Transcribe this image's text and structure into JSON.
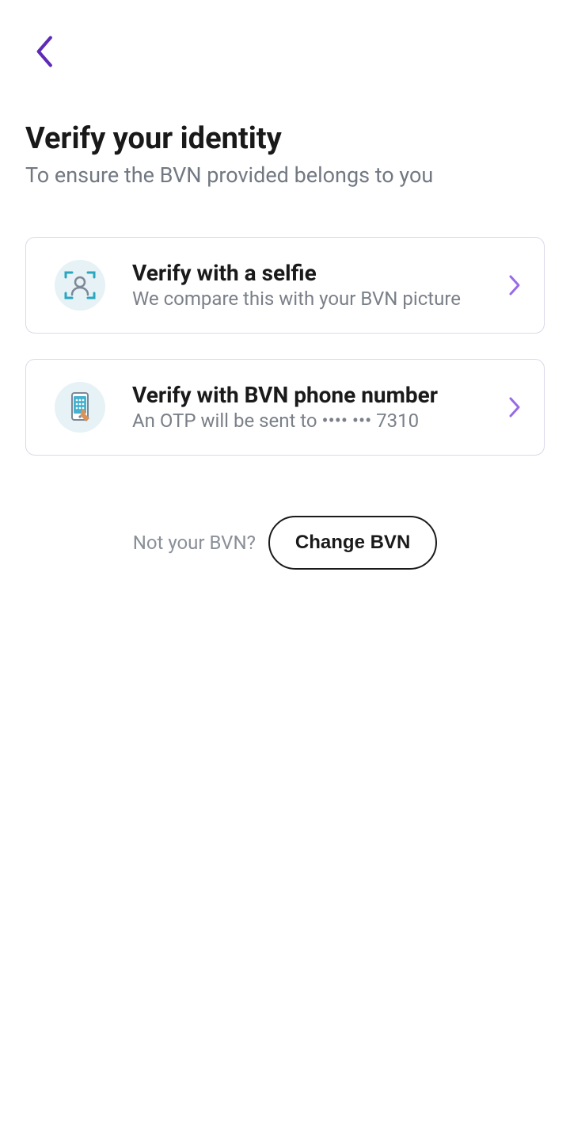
{
  "header": {
    "title": "Verify your identity",
    "subtitle": "To ensure the BVN provided belongs to you"
  },
  "options": {
    "selfie": {
      "title": "Verify with a selfie",
      "subtitle": "We compare this with your BVN picture"
    },
    "phone": {
      "title": "Verify with BVN phone number",
      "subtitle": "An OTP will be sent to •••• ••• 7310"
    }
  },
  "footer": {
    "not_your_label": "Not your BVN?",
    "change_bvn_label": "Change BVN"
  },
  "colors": {
    "accent": "#5e2bb7",
    "chevron": "#9a6ae6",
    "border": "#dcd7eb",
    "icon_bg": "#e6f2f6",
    "text_muted": "#7a7f88"
  }
}
